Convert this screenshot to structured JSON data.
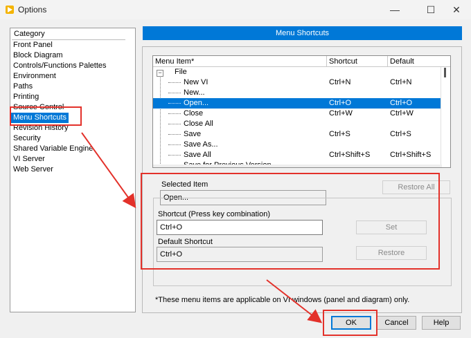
{
  "window": {
    "title": "Options",
    "minimize_glyph": "—",
    "maximize_glyph": "☐",
    "close_glyph": "✕"
  },
  "sidebar": {
    "header": "Category",
    "items": [
      {
        "label": "Front Panel"
      },
      {
        "label": "Block Diagram"
      },
      {
        "label": "Controls/Functions Palettes"
      },
      {
        "label": "Environment"
      },
      {
        "label": "Paths"
      },
      {
        "label": "Printing"
      },
      {
        "label": "Source Control"
      },
      {
        "label": "Menu Shortcuts",
        "selected": true
      },
      {
        "label": "Revision History"
      },
      {
        "label": "Security"
      },
      {
        "label": "Shared Variable Engine"
      },
      {
        "label": "VI Server"
      },
      {
        "label": "Web Server"
      }
    ]
  },
  "panel": {
    "title": "Menu Shortcuts",
    "table": {
      "columns": [
        "Menu Item*",
        "Shortcut",
        "Default"
      ],
      "rows": [
        {
          "item": "File",
          "shortcut": "",
          "default": "",
          "level": 0,
          "expand": "−"
        },
        {
          "item": "New VI",
          "shortcut": "Ctrl+N",
          "default": "Ctrl+N",
          "level": 1
        },
        {
          "item": "New...",
          "shortcut": "",
          "default": "",
          "level": 1
        },
        {
          "item": "Open...",
          "shortcut": "Ctrl+O",
          "default": "Ctrl+O",
          "level": 1,
          "selected": true
        },
        {
          "item": "Close",
          "shortcut": "Ctrl+W",
          "default": "Ctrl+W",
          "level": 1
        },
        {
          "item": "Close All",
          "shortcut": "",
          "default": "",
          "level": 1
        },
        {
          "item": "Save",
          "shortcut": "Ctrl+S",
          "default": "Ctrl+S",
          "level": 1
        },
        {
          "item": "Save As...",
          "shortcut": "",
          "default": "",
          "level": 1
        },
        {
          "item": "Save All",
          "shortcut": "Ctrl+Shift+S",
          "default": "Ctrl+Shift+S",
          "level": 1
        },
        {
          "item": "Save for Previous Version",
          "shortcut": "",
          "default": "",
          "level": 1
        }
      ]
    },
    "selected_item_label": "Selected Item",
    "selected_item_value": "Open...",
    "restore_all_label": "Restore All",
    "shortcut_label": "Shortcut (Press key combination)",
    "shortcut_value": "Ctrl+O",
    "set_label": "Set",
    "default_shortcut_label": "Default Shortcut",
    "default_shortcut_value": "Ctrl+O",
    "restore_label": "Restore",
    "note": "*These menu items are applicable on VI windows (panel and diagram) only."
  },
  "footer": {
    "ok_label": "OK",
    "cancel_label": "Cancel",
    "help_label": "Help"
  },
  "colors": {
    "selection": "#0078d7",
    "annotation": "#e3312a"
  }
}
